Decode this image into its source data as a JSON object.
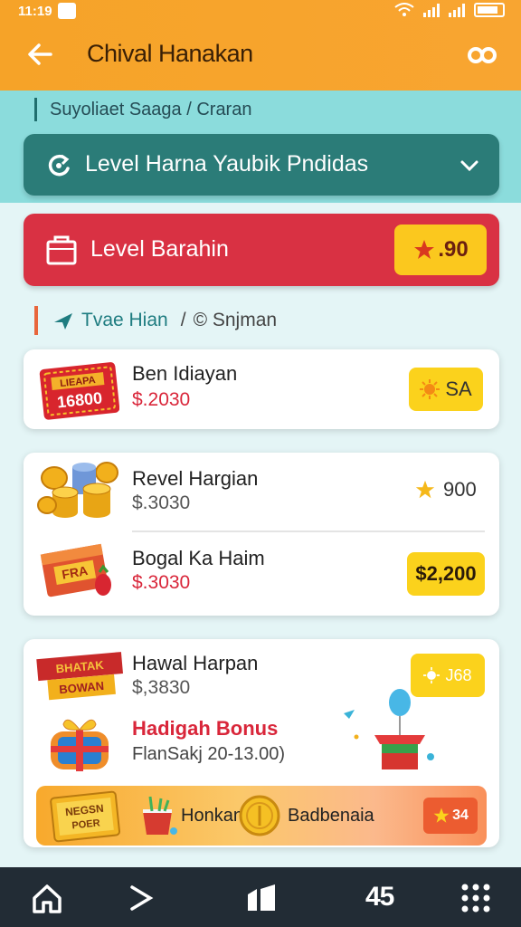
{
  "status_bar": {
    "time": "11:19"
  },
  "app_bar": {
    "title": "Chival Hanakan",
    "back_icon": "arrow-left-icon",
    "menu_icon": "infinity-link-icon"
  },
  "breadcrumb": {
    "text": "Suyoliaet Saaga  /  Craran"
  },
  "level_selector": {
    "label": "Level Harna Yaubik Pndidas",
    "icon": "cycle-icon",
    "dropdown_icon": "chevron-down-icon"
  },
  "level_banner": {
    "label": "Level Barahin",
    "badge": {
      "icon": "star-icon",
      "value": ".90"
    }
  },
  "section": {
    "icon": "plane-icon",
    "title": "Tvae Hian",
    "separator": "/",
    "subtitle": "© Snjman"
  },
  "card1": {
    "item": {
      "name": "Ben Idiayan",
      "price": "$.2030",
      "image_text_top": "LIEAPA",
      "image_text_bottom": "16800",
      "badge_value": "SA",
      "badge_icon": "sun-star-icon"
    }
  },
  "card2": {
    "items": [
      {
        "name": "Revel Hargian",
        "price": "$.3030",
        "reward": "900",
        "reward_icon": "star-icon"
      },
      {
        "name": "Bogal Ka Haim",
        "price": "$.3030",
        "reward": "$2,200",
        "image_text": "FRA"
      }
    ]
  },
  "card3": {
    "item": {
      "name": "Hawal Harpan",
      "price": "$,3830",
      "badge_value": "J68",
      "image_text_top": "BHATAK",
      "image_text_bottom": "BOWAN"
    },
    "bonus": {
      "title": "Hadigah Bonus",
      "subtitle": "FlanSakj 20-13.00)"
    },
    "promo": {
      "image_text_top": "NEGSN",
      "image_text_bottom": "POER",
      "label_left": "Honkan",
      "label_right": "Badbenaia",
      "badge_icon": "star-icon",
      "badge_value": "34"
    }
  },
  "bottom_nav": {
    "home_icon": "home-icon",
    "forward_icon": "chevron-right-icon",
    "cards_icon": "cards-icon",
    "count": "45",
    "more_icon": "grid-dots-icon"
  },
  "colors": {
    "header": "#f6a328",
    "teal": "#2b7c78",
    "red": "#d93143",
    "badge_yellow": "#fbd21c",
    "nav": "#222c35"
  }
}
